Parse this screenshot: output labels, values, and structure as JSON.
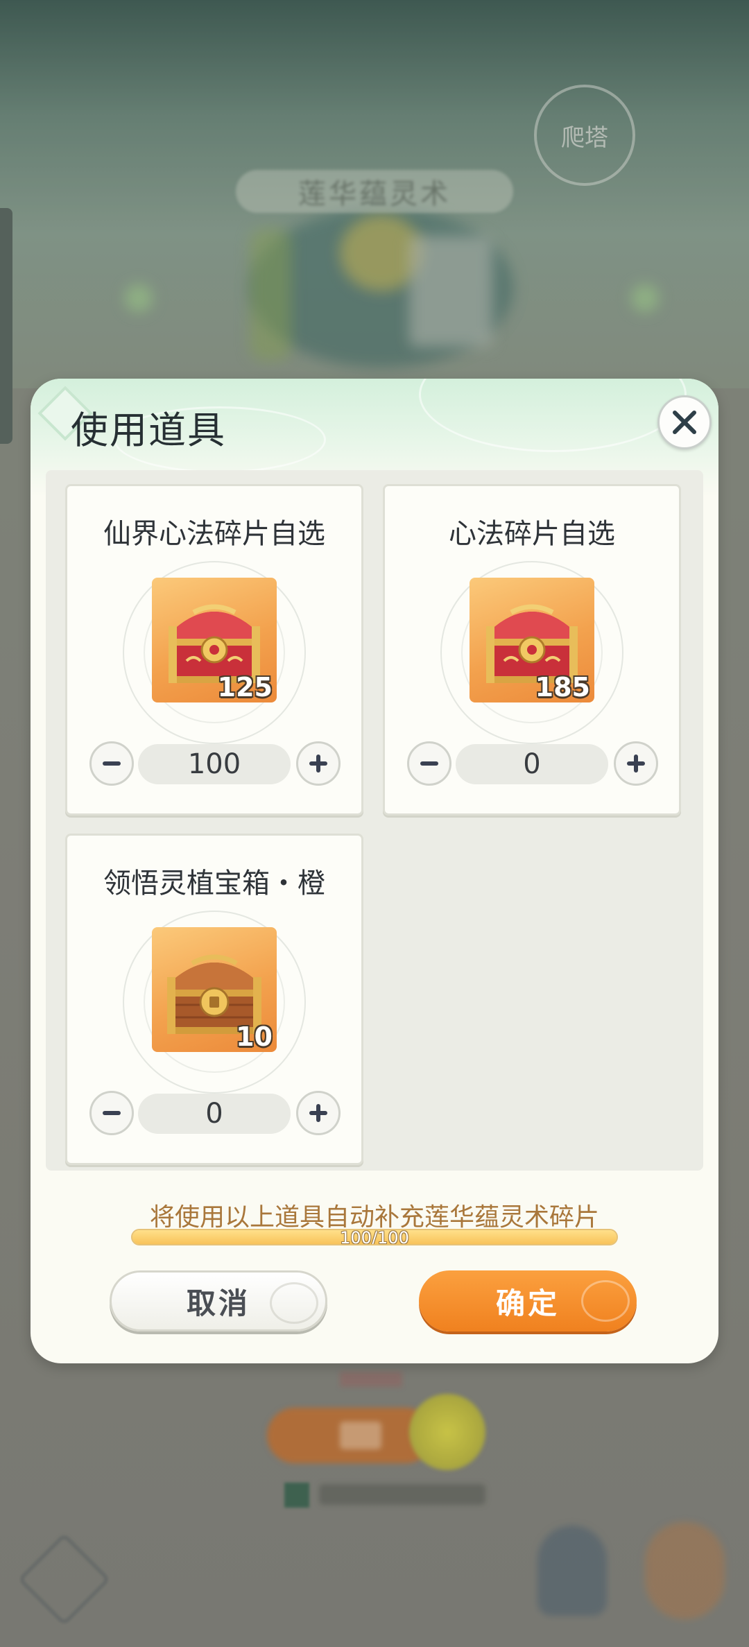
{
  "background": {
    "tower_button": "爬塔",
    "banner_title": "莲华蕴灵术"
  },
  "dialog": {
    "title": "使用道具",
    "close_icon": "close-icon",
    "items": [
      {
        "name": "仙界心法碎片自选",
        "count": "125",
        "quantity": "100",
        "chest": "red-gold-chest"
      },
      {
        "name": "心法碎片自选",
        "count": "185",
        "quantity": "0",
        "chest": "red-gold-chest"
      },
      {
        "name": "领悟灵植宝箱・橙",
        "count": "10",
        "quantity": "0",
        "chest": "wooden-chest"
      }
    ],
    "note": "将使用以上道具自动补充莲华蕴灵术碎片",
    "progress": {
      "text": "100/100",
      "value": 100,
      "max": 100
    },
    "cancel_label": "取消",
    "confirm_label": "确定"
  },
  "colors": {
    "accent_orange": "#f0811f",
    "note_brown": "#a9773b",
    "title_dark": "#262f33",
    "progress_fill": "#f8c35a"
  }
}
